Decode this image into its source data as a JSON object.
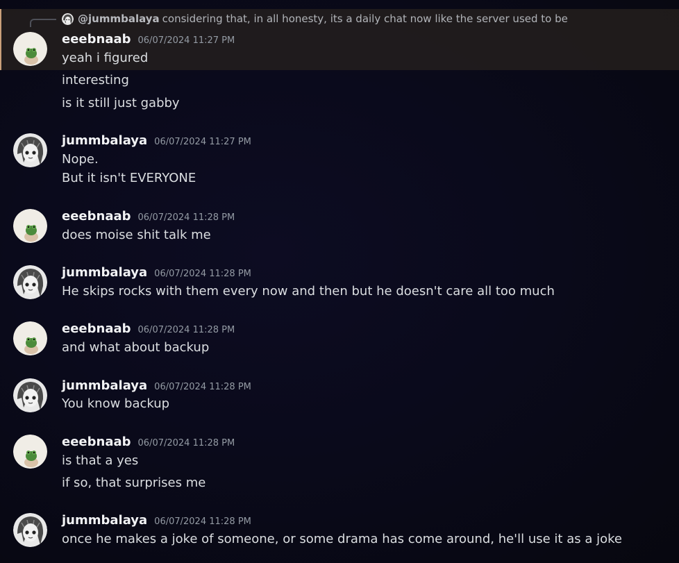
{
  "reply": {
    "target_username": "@jummbalaya",
    "target_avatar_icon": "anime-girl-avatar-icon",
    "preview_text": "considering that, in all honesty, its a daily chat now like the server used to be"
  },
  "messages": [
    {
      "username": "eeebnaab",
      "timestamp": "06/07/2024 11:27 PM",
      "avatar_icon": "frog-figurine-avatar-icon",
      "lines": [
        "yeah i figured",
        "interesting",
        "is it still just gabby"
      ]
    },
    {
      "username": "jummbalaya",
      "timestamp": "06/07/2024 11:27 PM",
      "avatar_icon": "anime-girl-avatar-icon",
      "lines": [
        "Nope.",
        "But it isn't EVERYONE"
      ]
    },
    {
      "username": "eeebnaab",
      "timestamp": "06/07/2024 11:28 PM",
      "avatar_icon": "frog-figurine-avatar-icon",
      "lines": [
        "does moise shit talk me"
      ]
    },
    {
      "username": "jummbalaya",
      "timestamp": "06/07/2024 11:28 PM",
      "avatar_icon": "anime-girl-avatar-icon",
      "lines": [
        "He skips rocks with them every now and then but he doesn't care all too much"
      ]
    },
    {
      "username": "eeebnaab",
      "timestamp": "06/07/2024 11:28 PM",
      "avatar_icon": "frog-figurine-avatar-icon",
      "lines": [
        "and what about backup"
      ]
    },
    {
      "username": "jummbalaya",
      "timestamp": "06/07/2024 11:28 PM",
      "avatar_icon": "anime-girl-avatar-icon",
      "lines": [
        "You know backup"
      ]
    },
    {
      "username": "eeebnaab",
      "timestamp": "06/07/2024 11:28 PM",
      "avatar_icon": "frog-figurine-avatar-icon",
      "lines": [
        "is that a yes",
        "if so, that surprises me"
      ]
    },
    {
      "username": "jummbalaya",
      "timestamp": "06/07/2024 11:28 PM",
      "avatar_icon": "anime-girl-avatar-icon",
      "lines": [
        "once he makes a joke of someone, or some drama has come around, he'll use it as a joke"
      ]
    }
  ],
  "colors": {
    "background": "#0a0a1b",
    "highlight_background": "#28221e",
    "highlight_border": "#c9a07a",
    "username": "#f2f3f5",
    "timestamp": "#949ba4",
    "message_text": "#dbdee1"
  }
}
